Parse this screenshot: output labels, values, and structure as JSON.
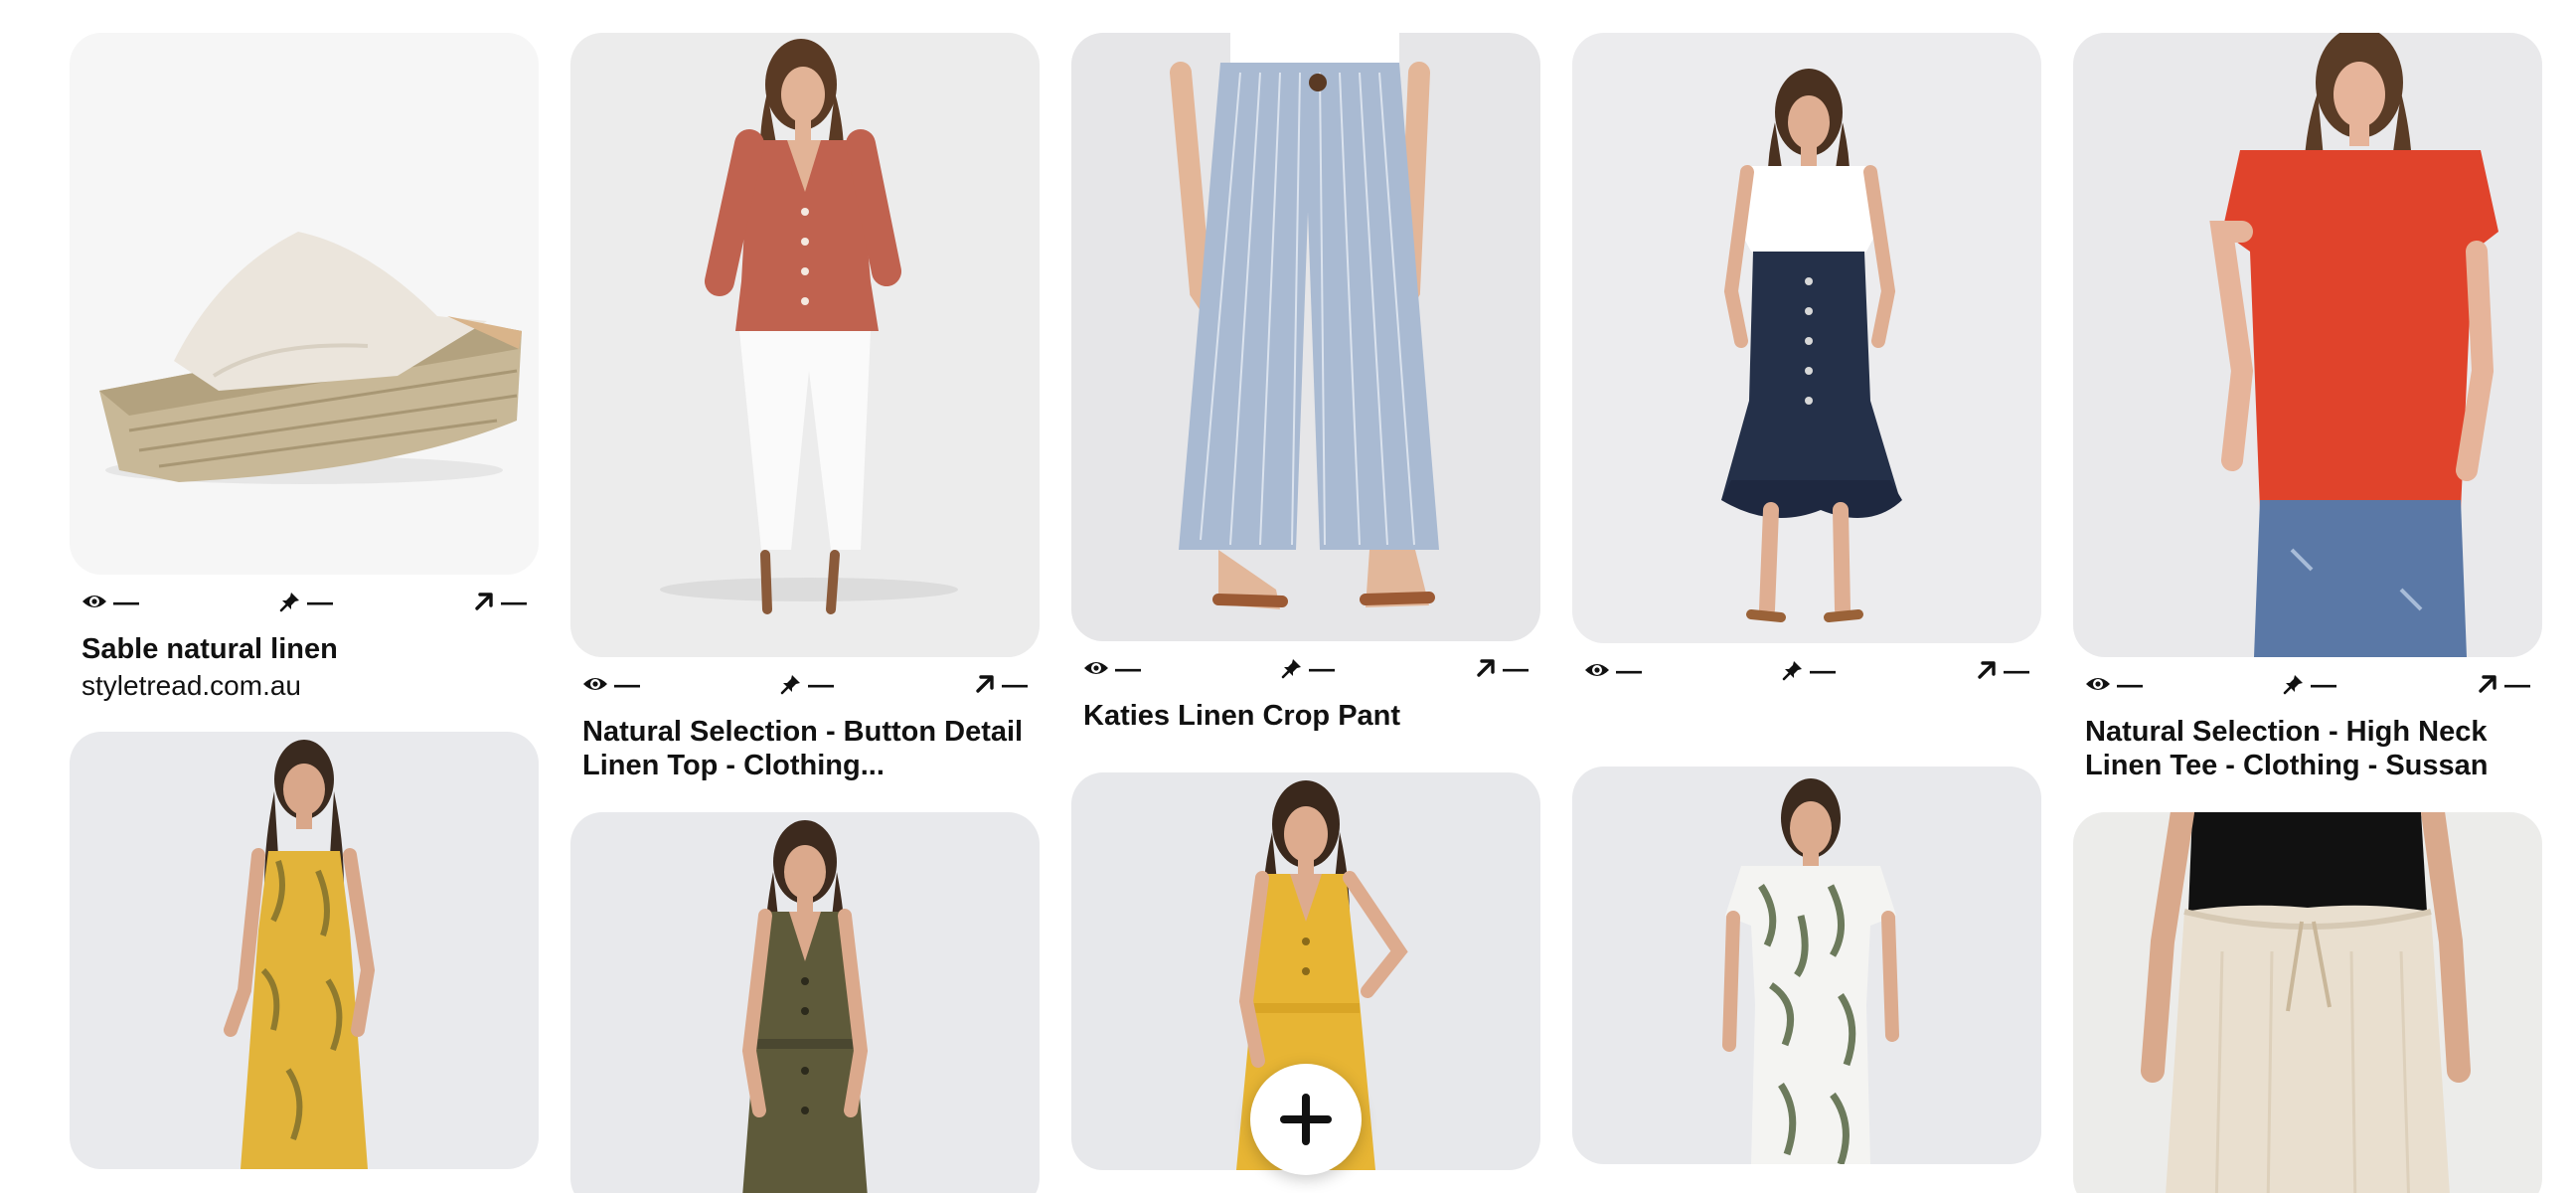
{
  "stat_placeholder": "—",
  "icons": {
    "views": "eye-icon",
    "saves": "pin-icon",
    "clicks": "outbound-arrow-icon",
    "create": "plus-icon"
  },
  "pins": [
    {
      "title": "Sable natural linen",
      "domain": "styletread.com.au",
      "image": "linen-espadrille-wedge-sandal"
    },
    {
      "title": "",
      "domain": "",
      "image": "yellow-leaf-print-jumpsuit"
    },
    {
      "title": "Natural Selection - Button Detail Linen Top - Clothing...",
      "domain": "",
      "image": "rust-button-linen-top"
    },
    {
      "title": "",
      "domain": "",
      "image": "olive-button-midi-dress"
    },
    {
      "title": "Katies Linen Crop Pant",
      "domain": "",
      "image": "blue-stripe-linen-crop-pant"
    },
    {
      "title": "",
      "domain": "",
      "image": "yellow-button-midi-dress"
    },
    {
      "title": "",
      "domain": "",
      "image": "navy-button-ruffle-skirt"
    },
    {
      "title": "",
      "domain": "",
      "image": "leaf-print-tshirt-dress"
    },
    {
      "title": "Natural Selection - High Neck Linen Tee - Clothing - Sussan",
      "domain": "",
      "image": "red-linen-tee"
    },
    {
      "title": "",
      "domain": "",
      "image": "natural-linen-drawstring-pant"
    }
  ]
}
